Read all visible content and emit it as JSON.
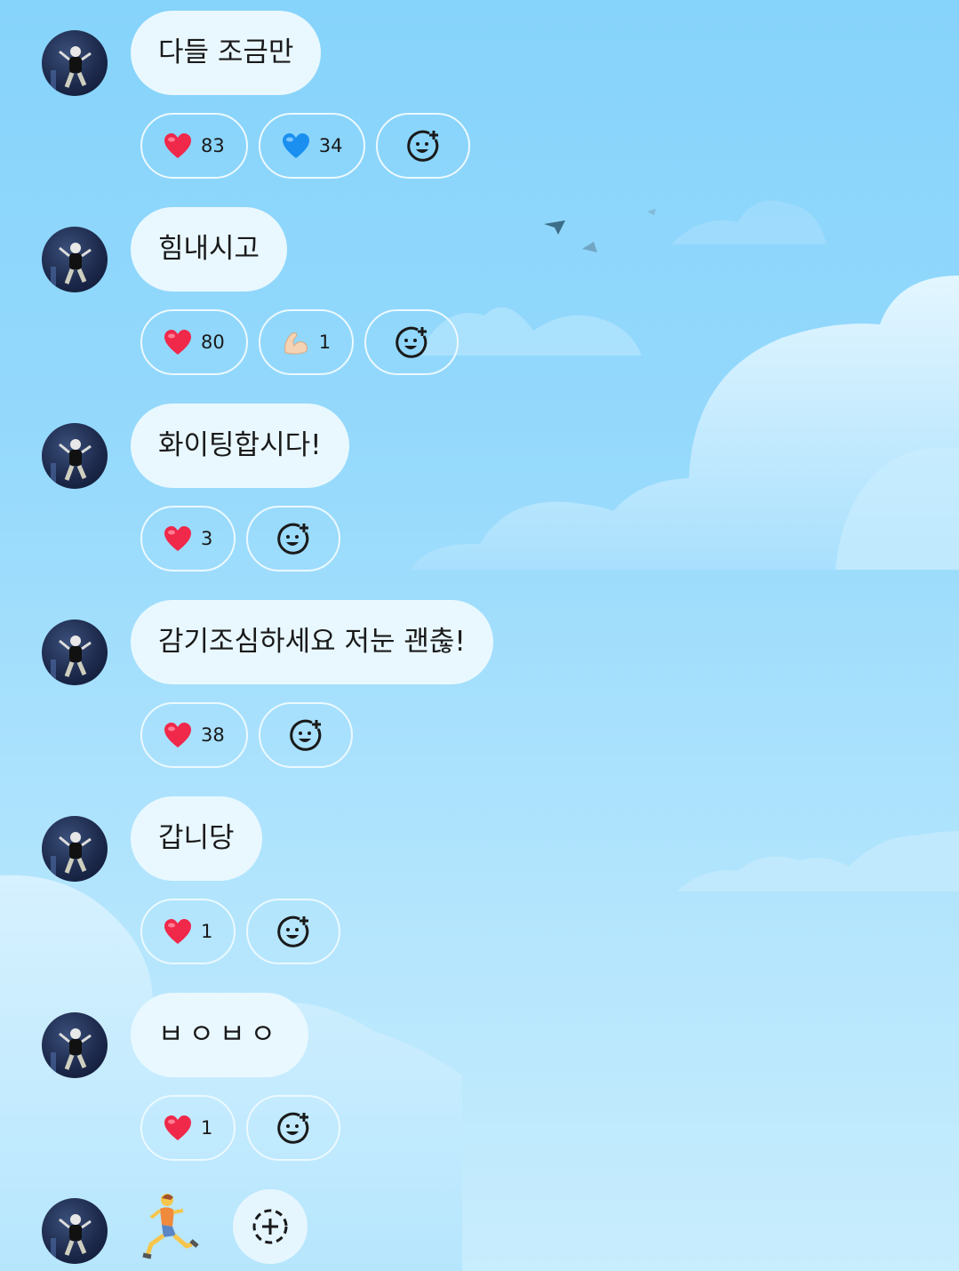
{
  "messages": [
    {
      "text": "다들 조금만",
      "reactions": [
        {
          "emoji": "red-heart",
          "count": "83"
        },
        {
          "emoji": "blue-heart",
          "count": "34"
        }
      ]
    },
    {
      "text": "힘내시고",
      "reactions": [
        {
          "emoji": "red-heart",
          "count": "80"
        },
        {
          "emoji": "flexed-biceps",
          "count": "1"
        }
      ]
    },
    {
      "text": "화이팅합시다!",
      "reactions": [
        {
          "emoji": "red-heart",
          "count": "3"
        }
      ]
    },
    {
      "text": "감기조심하세요 저눈 괜춚!",
      "reactions": [
        {
          "emoji": "red-heart",
          "count": "38"
        }
      ]
    },
    {
      "text": "갑니당",
      "reactions": [
        {
          "emoji": "red-heart",
          "count": "1"
        }
      ]
    },
    {
      "text": "ㅂㅇㅂㅇ",
      "reactions": [
        {
          "emoji": "red-heart",
          "count": "1"
        }
      ]
    }
  ],
  "last_message": {
    "emoji": "person-running"
  },
  "icons": {
    "add_reaction": "add-reaction-icon",
    "add": "dashed-plus-icon"
  },
  "colors": {
    "bubble": "#e9f8ff",
    "pill_border": "#ecf9ff",
    "sky_top": "#86d3fb",
    "sky_bottom": "#c8edfd"
  }
}
